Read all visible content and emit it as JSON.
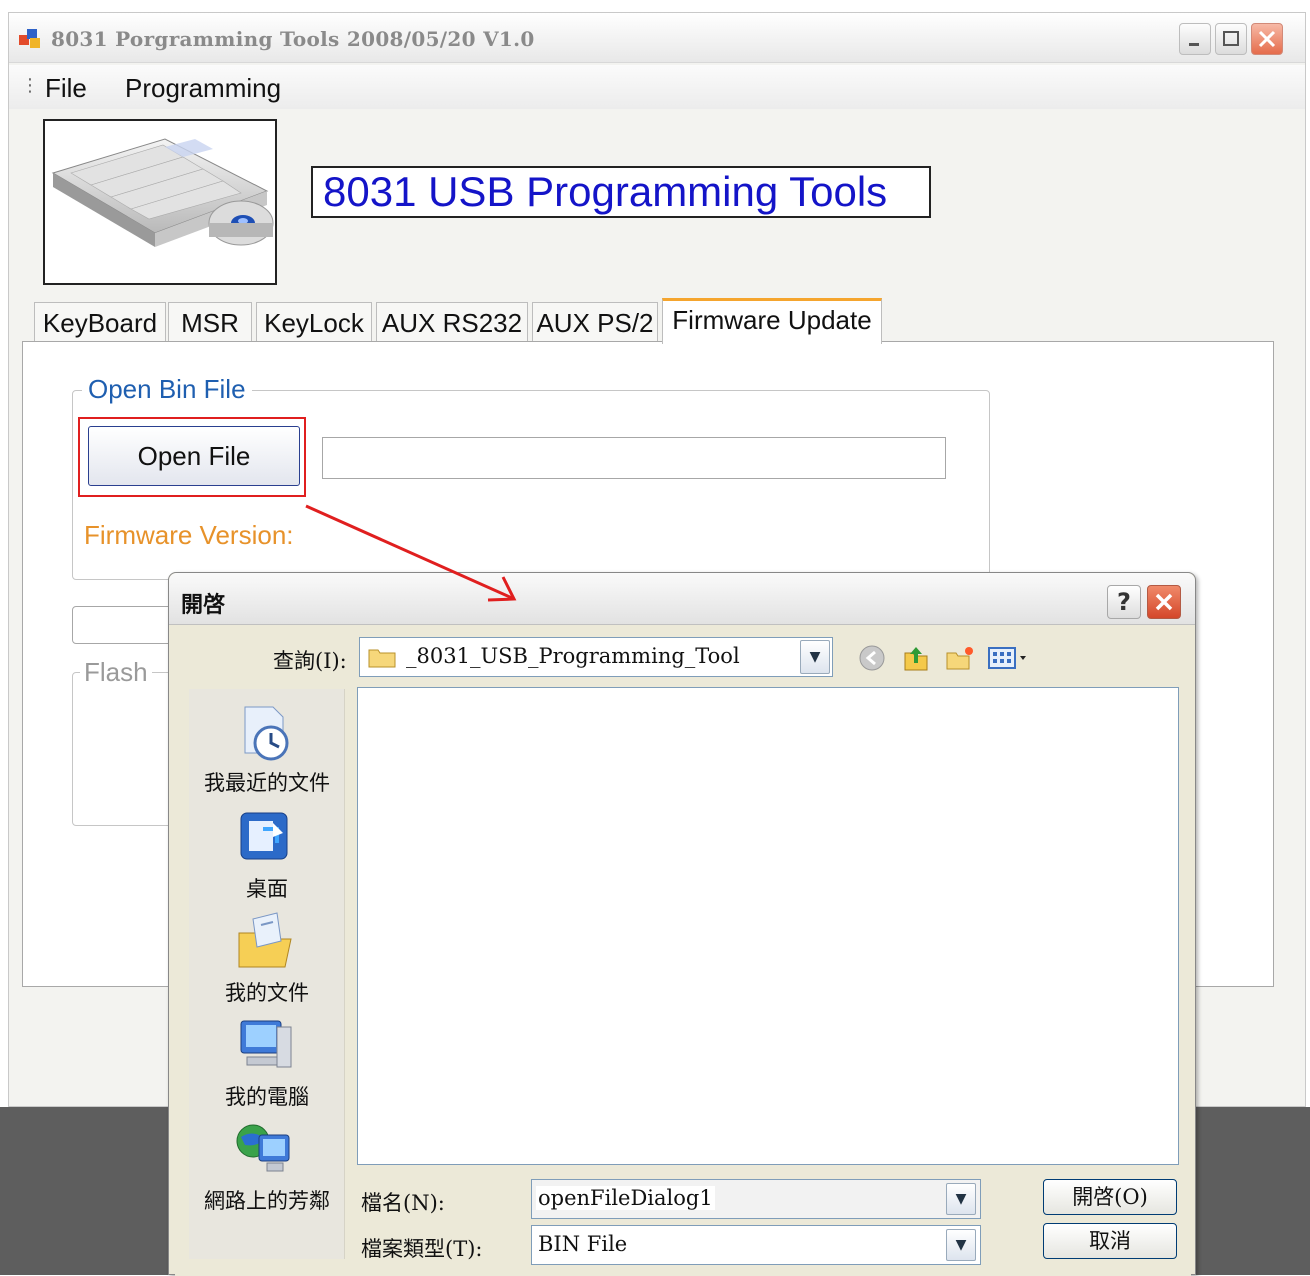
{
  "window": {
    "title": "8031 Porgramming Tools 2008/05/20 V1.0"
  },
  "menu": {
    "items": [
      "File",
      "Programming"
    ]
  },
  "header": {
    "heading": "8031 USB Programming Tools",
    "logo_icon": "keyboard-image"
  },
  "tabs": [
    {
      "label": "KeyBoard"
    },
    {
      "label": "MSR"
    },
    {
      "label": "KeyLock"
    },
    {
      "label": "AUX RS232"
    },
    {
      "label": "AUX PS/2"
    },
    {
      "label": "Firmware Update",
      "active": true
    }
  ],
  "firmware_tab": {
    "open_group_title": "Open Bin File",
    "open_file_button": "Open File",
    "file_path_value": "",
    "firmware_version_label": "Firmware Version:",
    "flash_group_title": "Flash"
  },
  "dialog": {
    "title": "開啓",
    "help_button": "?",
    "look_in_label": "查詢(I):",
    "look_in_value": "_8031_USB_Programming_Tool",
    "places": [
      {
        "label": "我最近的文件",
        "icon": "recent-documents-icon"
      },
      {
        "label": "桌面",
        "icon": "desktop-icon"
      },
      {
        "label": "我的文件",
        "icon": "my-documents-icon"
      },
      {
        "label": "我的電腦",
        "icon": "my-computer-icon"
      },
      {
        "label": "網路上的芳鄰",
        "icon": "network-places-icon"
      }
    ],
    "filename_label": "檔名(N):",
    "filename_value": "openFileDialog1",
    "filetype_label": "檔案類型(T):",
    "filetype_value": "BIN File",
    "open_button": "開啓(O)",
    "cancel_button": "取消"
  },
  "colors": {
    "heading_text": "#1414c8",
    "group_title": "#1f5fb0",
    "firmware_version_text": "#e7922a",
    "highlight_border": "#e01f1f",
    "active_tab_accent": "#f5a52e"
  }
}
